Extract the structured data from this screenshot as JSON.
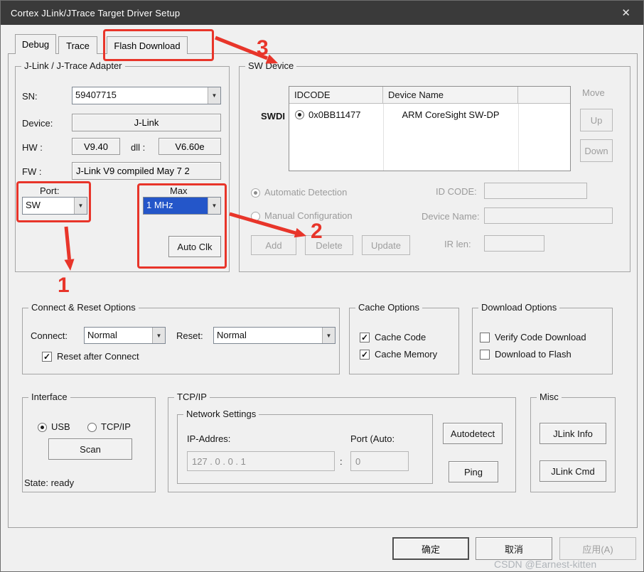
{
  "window": {
    "title": "Cortex JLink/JTrace Target Driver Setup"
  },
  "icons": {
    "close": "✕",
    "dropdown": "▼",
    "check": "✓"
  },
  "tabs": {
    "debug": "Debug",
    "trace": "Trace",
    "flash_download": "Flash Download"
  },
  "adapter": {
    "legend": "J-Link / J-Trace Adapter",
    "sn_label": "SN:",
    "sn_value": "59407715",
    "device_label": "Device:",
    "device_value": "J-Link",
    "hw_label": "HW :",
    "hw_value": "V9.40",
    "dll_label": "dll :",
    "dll_value": "V6.60e",
    "fw_label": "FW :",
    "fw_value": "J-Link V9 compiled May  7 2",
    "port_label": "Port:",
    "port_value": "SW",
    "max_label": "Max",
    "max_value": "1 MHz",
    "auto_clk_button": "Auto Clk"
  },
  "sw_device": {
    "legend": "SW Device",
    "table": {
      "columns": [
        "IDCODE",
        "Device Name"
      ],
      "row_header": "SWDI",
      "rows": [
        {
          "idcode": "0x0BB11477",
          "device_name": "ARM CoreSight SW-DP",
          "selected": true
        }
      ]
    },
    "move_label": "Move",
    "up_button": "Up",
    "down_button": "Down",
    "automatic_detection": "Automatic Detection",
    "manual_configuration": "Manual Configuration",
    "id_code_label": "ID CODE:",
    "id_code_value": "",
    "device_name_label": "Device Name:",
    "device_name_value": "",
    "add_button": "Add",
    "delete_button": "Delete",
    "update_button": "Update",
    "ir_len_label": "IR len:",
    "ir_len_value": ""
  },
  "connect_reset": {
    "legend": "Connect & Reset Options",
    "connect_label": "Connect:",
    "connect_value": "Normal",
    "reset_label": "Reset:",
    "reset_value": "Normal",
    "reset_after_connect": "Reset after Connect",
    "reset_after_connect_checked": true
  },
  "cache_options": {
    "legend": "Cache Options",
    "cache_code": "Cache Code",
    "cache_memory": "Cache Memory",
    "cache_code_checked": true,
    "cache_memory_checked": true
  },
  "download_options": {
    "legend": "Download Options",
    "verify_code_download": "Verify Code Download",
    "download_to_flash": "Download to Flash",
    "verify_checked": false,
    "flash_checked": false
  },
  "interface": {
    "legend": "Interface",
    "usb": "USB",
    "tcpip": "TCP/IP",
    "usb_selected": true,
    "scan_button": "Scan",
    "state": "State: ready"
  },
  "tcpip": {
    "legend": "TCP/IP",
    "network_settings_legend": "Network Settings",
    "ip_label": "IP-Addres:",
    "ip_value": "127  .   0   .   0   .   1",
    "separator": ":",
    "port_label": "Port (Auto:",
    "port_value": "0",
    "autodetect_button": "Autodetect",
    "ping_button": "Ping"
  },
  "misc": {
    "legend": "Misc",
    "jlink_info_button": "JLink Info",
    "jlink_cmd_button": "JLink Cmd"
  },
  "footer": {
    "ok_button": "确定",
    "cancel_button": "取消",
    "apply_button": "应用(A)"
  },
  "watermark": "CSDN @Earnest-kitten",
  "annotations": {
    "step1": "1",
    "step2": "2",
    "step3": "3"
  },
  "colors": {
    "annotation_red": "#e8352a",
    "selection_blue": "#2456c9",
    "titlebar": "#3a3a3a"
  }
}
